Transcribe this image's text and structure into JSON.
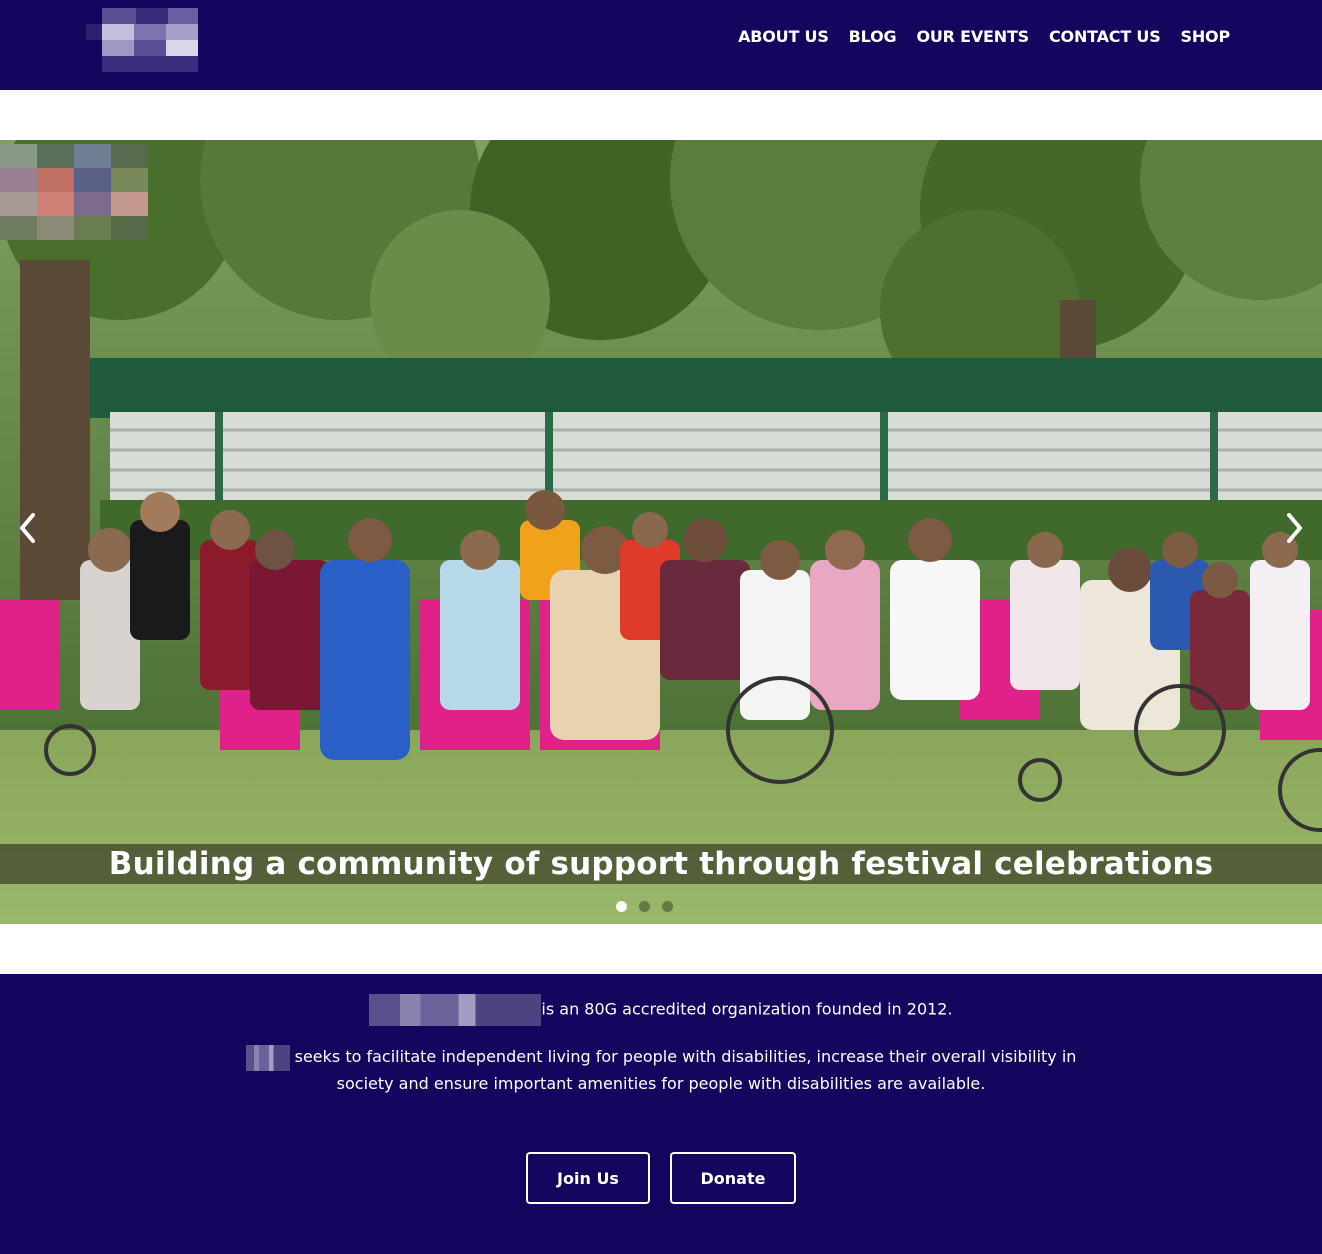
{
  "header": {
    "nav": [
      "ABOUT US",
      "BLOG",
      "OUR EVENTS",
      "CONTACT US",
      "SHOP"
    ]
  },
  "carousel": {
    "caption": "Building a community of support through festival celebrations",
    "slide_count": 3,
    "active_slide": 1
  },
  "intro": {
    "line1": "is an 80G accredited organization founded in 2012.",
    "line2": "seeks to facilitate independent living for people with disabilities, increase their overall visibility in society and ensure important amenities for people with disabilities are available."
  },
  "buttons": {
    "join": "Join Us",
    "donate": "Donate"
  },
  "colors": {
    "brand": "#14065e",
    "accent_pink": "#e0218a"
  },
  "icons": [
    "chevron-left-icon",
    "chevron-right-icon"
  ]
}
